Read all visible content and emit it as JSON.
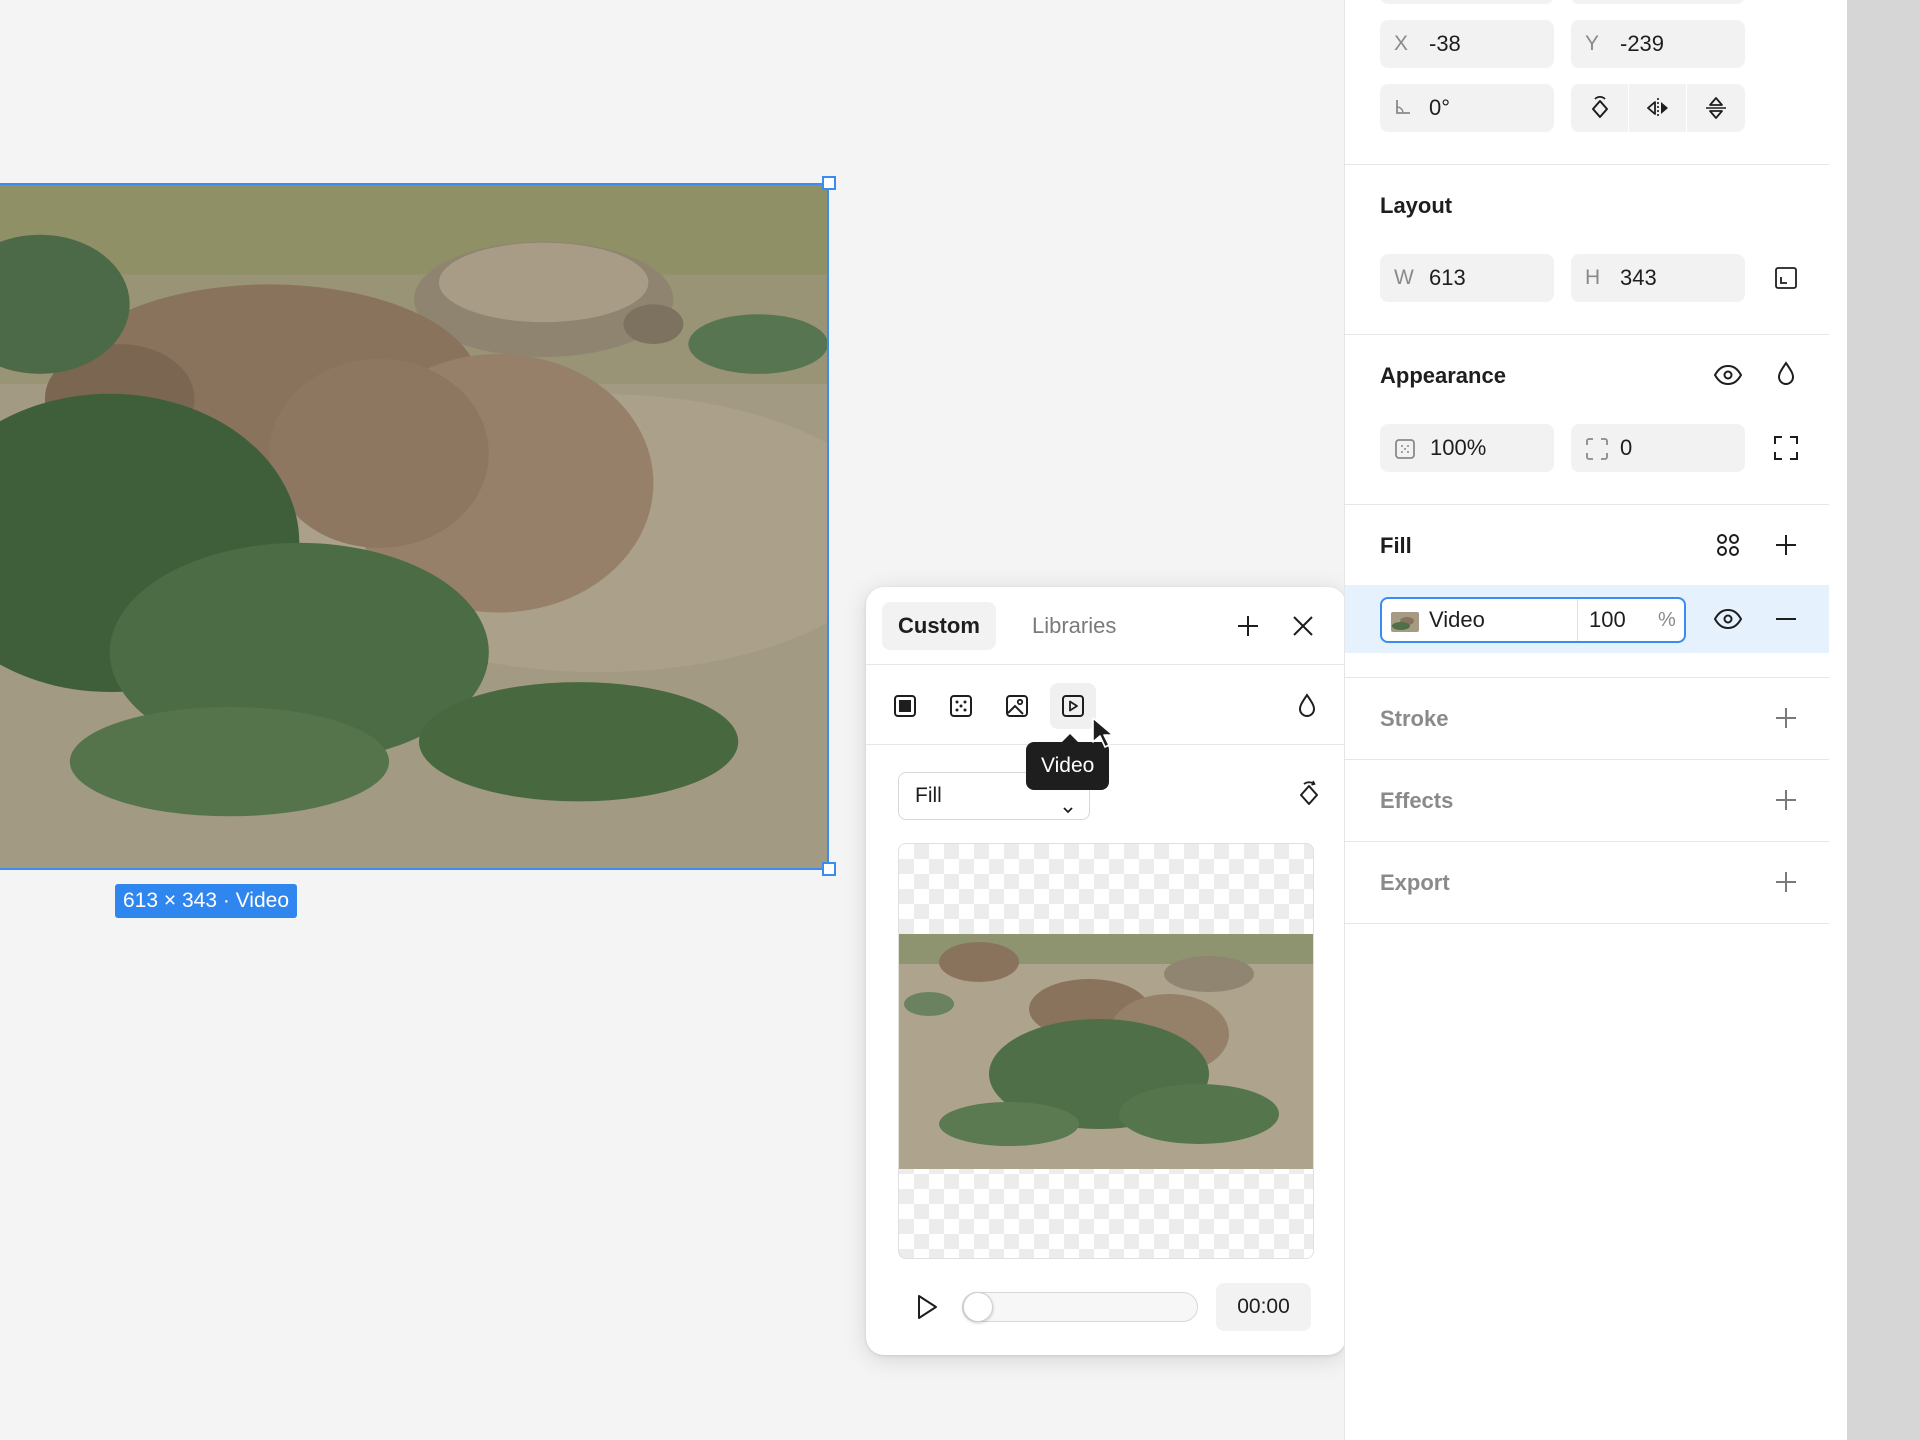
{
  "canvas": {
    "selection_badge": "613 × 343 · Video"
  },
  "popover": {
    "tabs": [
      {
        "label": "Custom",
        "active": true
      },
      {
        "label": "Libraries",
        "active": false
      }
    ],
    "fill_types": [
      "solid-fill-icon",
      "gradient-fill-icon",
      "image-fill-icon",
      "video-fill-icon"
    ],
    "active_fill_type": "video-fill-icon",
    "tooltip": "Video",
    "mode": "Fill",
    "playback": {
      "time": "00:00",
      "progress": 0
    }
  },
  "panel": {
    "position": {
      "x_label": "X",
      "x_value": "-38",
      "y_label": "Y",
      "y_value": "-239",
      "rotation": "0°"
    },
    "layout": {
      "title": "Layout",
      "w_label": "W",
      "w_value": "613",
      "h_label": "H",
      "h_value": "343"
    },
    "appearance": {
      "title": "Appearance",
      "opacity": "100%",
      "radius": "0"
    },
    "fill": {
      "title": "Fill",
      "layer_name": "Video",
      "opacity": "100",
      "percent_sign": "%"
    },
    "stroke": {
      "title": "Stroke"
    },
    "effects": {
      "title": "Effects"
    },
    "export": {
      "title": "Export"
    }
  },
  "colors": {
    "accent": "#3a8cf0",
    "selection_row": "#e5f1fd",
    "tooltip_bg": "#1e1e1e"
  }
}
